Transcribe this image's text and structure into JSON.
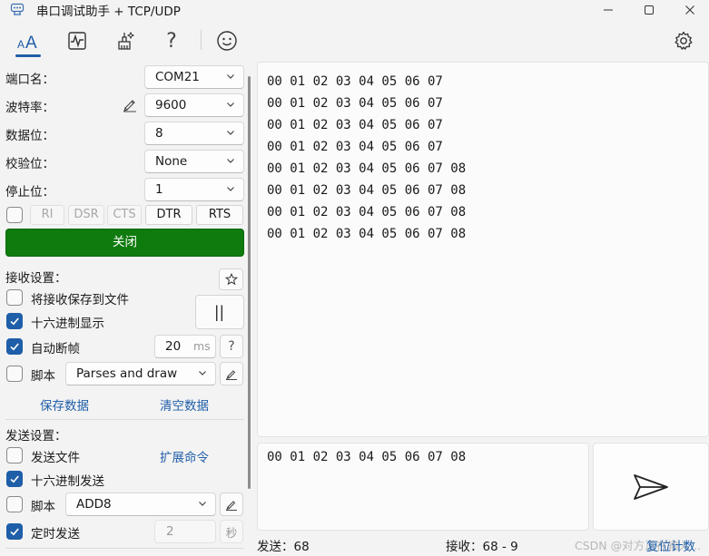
{
  "window": {
    "title": "串口调试助手 + TCP/UDP",
    "icon": "serial-port-icon"
  },
  "toolbar": {
    "items": [
      "font-icon",
      "chart-icon",
      "clean-icon",
      "help-icon",
      "smile-icon",
      "gear-icon"
    ],
    "help_glyph": "?",
    "active": "font-icon"
  },
  "serial": {
    "port_label": "端口名：",
    "port_value": "COM21",
    "baud_label": "波特率：",
    "baud_value": "9600",
    "databits_label": "数据位：",
    "databits_value": "8",
    "parity_label": "校验位：",
    "parity_value": "None",
    "stopbits_label": "停止位：",
    "stopbits_value": "1",
    "pins": [
      "RI",
      "DSR",
      "CTS",
      "DTR",
      "RTS"
    ],
    "pins_active": [
      "DTR",
      "RTS"
    ],
    "open_close_label": "关闭",
    "open_color": "#0f7b0f"
  },
  "receive": {
    "section_label": "接收设置：",
    "save_to_file_label": "将接收保存到文件",
    "save_to_file_checked": false,
    "hex_display_label": "十六进制显示",
    "hex_display_checked": true,
    "auto_frame_label": "自动断帧",
    "auto_frame_checked": true,
    "auto_frame_value": "20",
    "auto_frame_unit": "ms",
    "auto_frame_help": "?",
    "script_label": "脚本",
    "script_checked": false,
    "script_value": "Parses and draw",
    "pause_glyph": "||",
    "save_data_label": "保存数据",
    "clear_data_label": "清空数据",
    "lines": [
      "00 01 02 03 04 05 06 07",
      "00 01 02 03 04 05 06 07",
      "00 01 02 03 04 05 06 07",
      "00 01 02 03 04 05 06 07",
      "00 01 02 03 04 05 06 07 08",
      "00 01 02 03 04 05 06 07 08",
      "00 01 02 03 04 05 06 07 08",
      "00 01 02 03 04 05 06 07 08"
    ]
  },
  "send": {
    "section_label": "发送设置：",
    "send_file_label": "发送文件",
    "send_file_checked": false,
    "extend_cmd_label": "扩展命令",
    "hex_send_label": "十六进制发送",
    "hex_send_checked": true,
    "script_label": "脚本",
    "script_checked": false,
    "script_value": "ADD8",
    "timed_send_label": "定时发送",
    "timed_send_checked": true,
    "timed_value": "2",
    "timed_unit": "秒",
    "content": "00 01 02 03 04 05 06 07 08"
  },
  "status": {
    "sent": "发送：68",
    "received": "接收：68 - 9",
    "reset_label": "复位计数",
    "watermark": "CSDN @对方正在输入..."
  },
  "colors": {
    "accent": "#1f5ea8",
    "open_button": "#0f7b0f"
  }
}
